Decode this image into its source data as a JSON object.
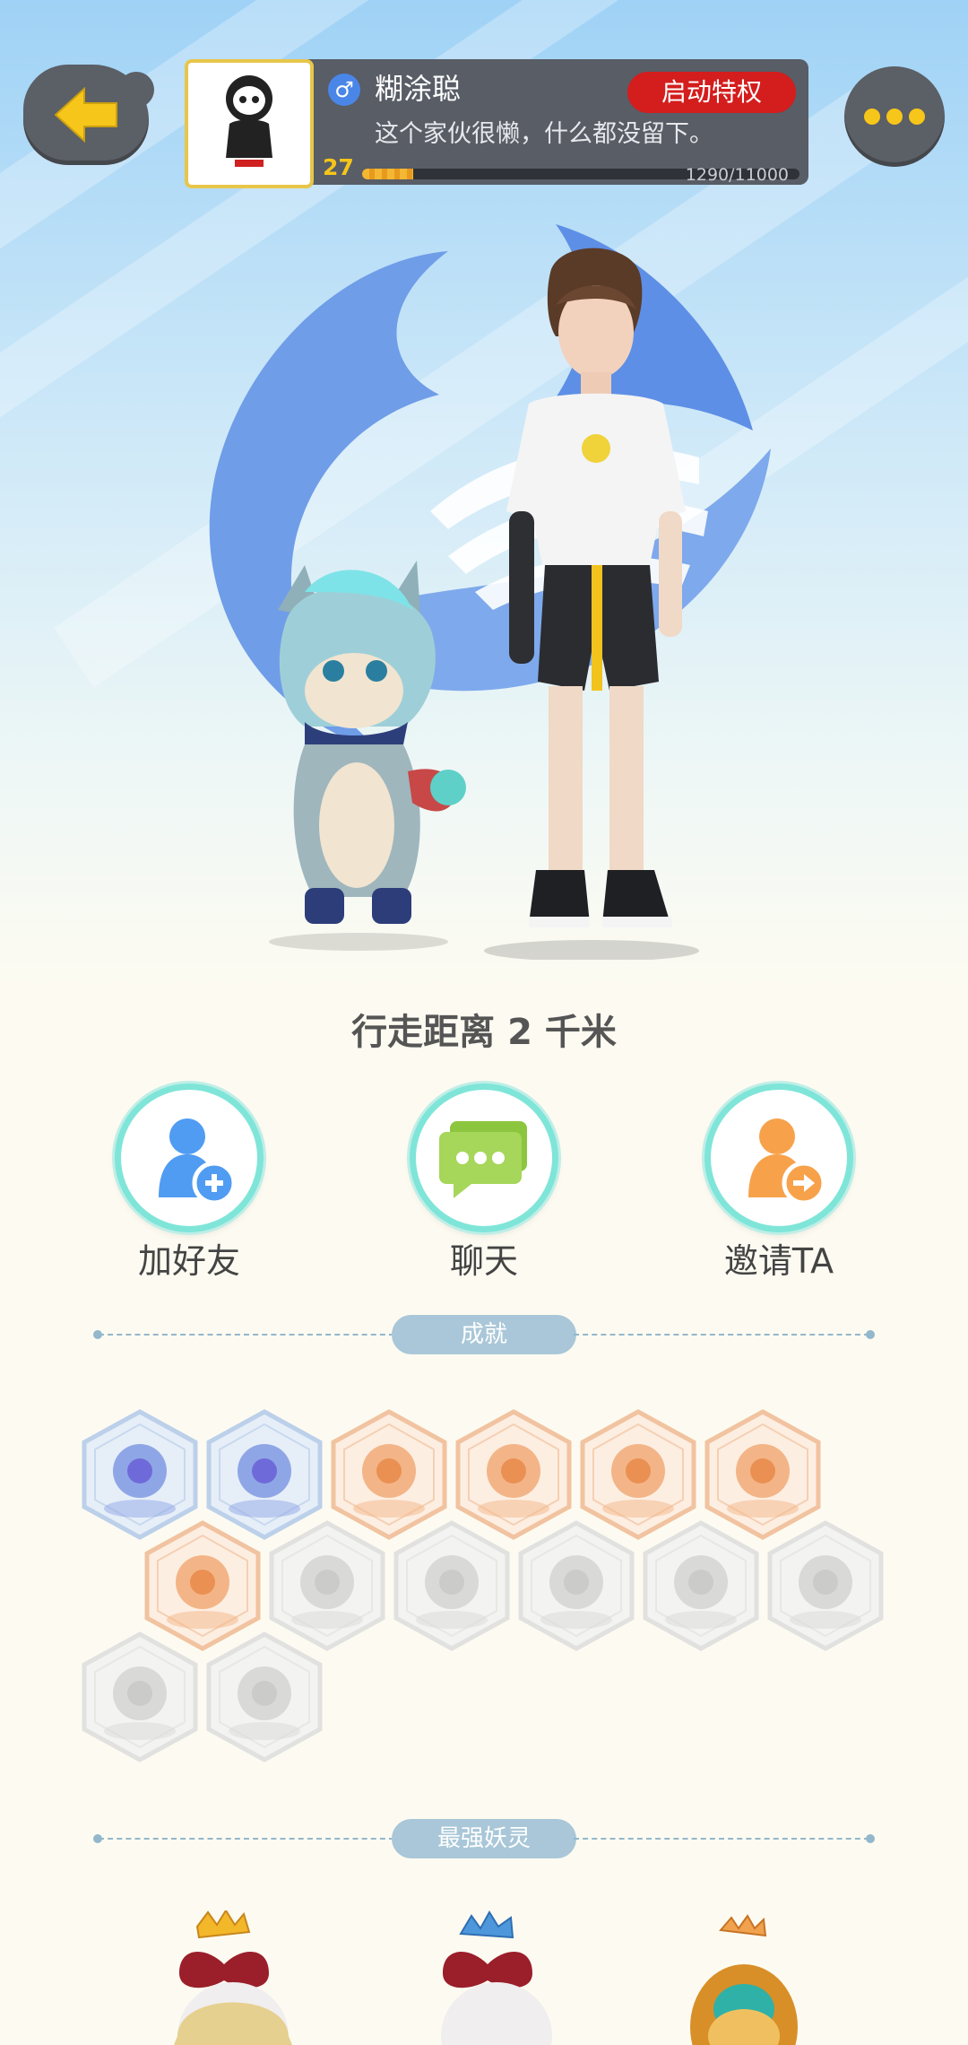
{
  "header": {
    "back_icon": "arrow-left-icon",
    "more_icon": "more-dots-icon",
    "nickname": "糊涂聪",
    "gender": "♂",
    "privilege_button": "启动特权",
    "signature": "这个家伙很懒，什么都没留下。",
    "level": "27",
    "xp_text": "1290/11000",
    "xp_progress": 0.117
  },
  "walk_distance": "行走距离 2 千米",
  "actions": [
    {
      "label": "加好友",
      "icon": "add-friend-icon"
    },
    {
      "label": "聊天",
      "icon": "chat-bubble-icon"
    },
    {
      "label": "邀请TA",
      "icon": "invite-icon"
    }
  ],
  "achievements": {
    "title": "成就",
    "badges": [
      {
        "icon": "orb-badge-icon",
        "state": "unlocked-blue"
      },
      {
        "icon": "cat-mask-badge-icon",
        "state": "unlocked-blue"
      },
      {
        "icon": "moon-badge-icon",
        "state": "unlocked-orange"
      },
      {
        "icon": "hand-orb-badge-icon",
        "state": "unlocked-orange"
      },
      {
        "icon": "yin-yang-comet-badge-icon",
        "state": "unlocked-orange"
      },
      {
        "icon": "gingerbread-badge-icon",
        "state": "unlocked-orange"
      },
      {
        "icon": "yin-yang-book-badge-icon",
        "state": "unlocked-orange"
      },
      {
        "icon": "sneaker-badge-icon",
        "state": "locked"
      },
      {
        "icon": "egg-badge-icon",
        "state": "locked"
      },
      {
        "icon": "stroller-badge-icon",
        "state": "locked"
      },
      {
        "icon": "cat-balloon-badge-icon",
        "state": "locked"
      },
      {
        "icon": "dragon-badge-icon",
        "state": "locked"
      },
      {
        "icon": "scroll-badge-icon",
        "state": "locked"
      },
      {
        "icon": "book-creature-badge-icon",
        "state": "locked"
      }
    ]
  },
  "strongest_pets": {
    "title": "最强妖灵",
    "pets": [
      {
        "icon": "crowned-pet-gold-icon"
      },
      {
        "icon": "crowned-pet-blue-icon"
      },
      {
        "icon": "crowned-pet-bronze-icon"
      }
    ]
  },
  "colors": {
    "accent_red": "#d41d1d",
    "level_gold": "#f5c519",
    "ring_teal": "#7fe5d8"
  }
}
